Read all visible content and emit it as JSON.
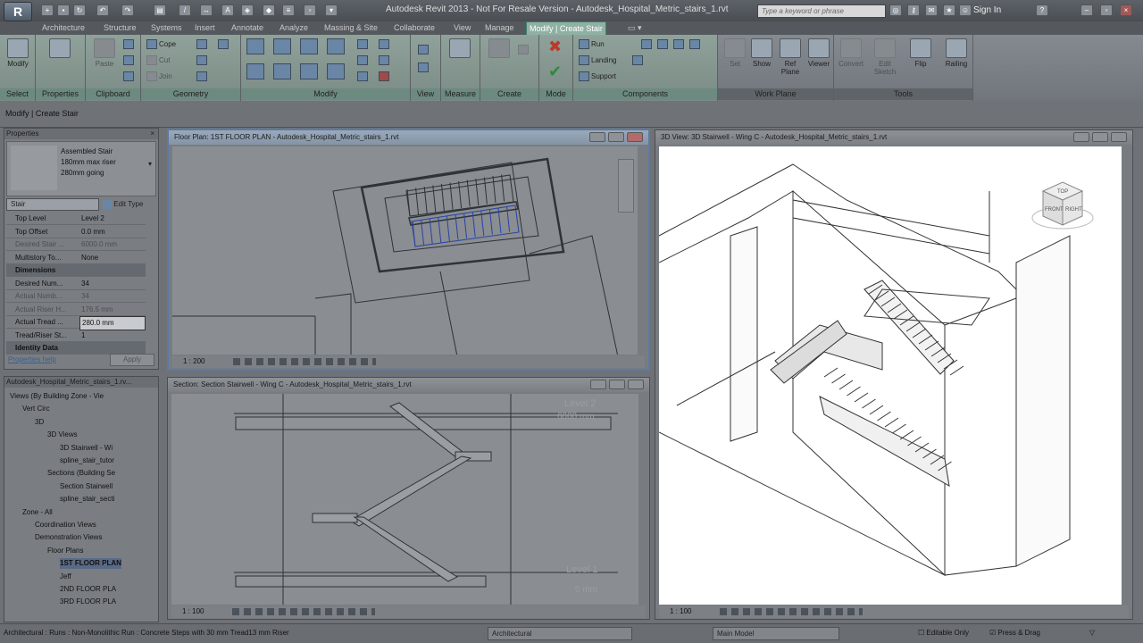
{
  "app": {
    "title": "Autodesk Revit 2013 - Not For Resale Version -   Autodesk_Hospital_Metric_stairs_1.rvt",
    "logo": "R",
    "search_placeholder": "Type a keyword or phrase",
    "sign_in": "Sign In"
  },
  "tabs": [
    "Architecture",
    "Structure",
    "Systems",
    "Insert",
    "Annotate",
    "Analyze",
    "Massing & Site",
    "Collaborate",
    "View",
    "Manage",
    "Modify | Create Stair"
  ],
  "ribbon": {
    "select": {
      "label": "Select",
      "modify": "Modify"
    },
    "properties": {
      "label": "Properties"
    },
    "clipboard": {
      "label": "Clipboard",
      "paste": "Paste"
    },
    "geometry": {
      "label": "Geometry",
      "cope": "Cope",
      "cut": "Cut",
      "join": "Join"
    },
    "modify": {
      "label": "Modify"
    },
    "view": {
      "label": "View"
    },
    "measure": {
      "label": "Measure"
    },
    "create": {
      "label": "Create"
    },
    "mode": {
      "label": "Mode"
    },
    "components": {
      "label": "Components",
      "run": "Run",
      "landing": "Landing",
      "support": "Support"
    },
    "workplane": {
      "label": "Work Plane",
      "set": "Set",
      "show": "Show",
      "refplane": "Ref Plane",
      "viewer": "Viewer"
    },
    "tools": {
      "label": "Tools",
      "convert": "Convert",
      "edit_sketch": "Edit Sketch",
      "flip": "Flip",
      "railing": "Railing"
    }
  },
  "options_bar": "Modify | Create Stair",
  "properties": {
    "header": "Properties",
    "type_line1": "Assembled Stair",
    "type_line2": "180mm max riser",
    "type_line3": "280mm going",
    "category": "Stair",
    "edit_type": "Edit Type",
    "rows": [
      {
        "name": "Top Level",
        "value": "Level 2",
        "kind": "row"
      },
      {
        "name": "Top Offset",
        "value": "0.0 mm",
        "kind": "row"
      },
      {
        "name": "Desired Stair ...",
        "value": "6000.0 mm",
        "kind": "grey"
      },
      {
        "name": "Multistory To...",
        "value": "None",
        "kind": "row"
      },
      {
        "name": "Dimensions",
        "value": "",
        "kind": "group"
      },
      {
        "name": "Desired Num...",
        "value": "34",
        "kind": "row"
      },
      {
        "name": "Actual Numb...",
        "value": "34",
        "kind": "grey"
      },
      {
        "name": "Actual Riser H...",
        "value": "176.5 mm",
        "kind": "grey"
      },
      {
        "name": "Actual Tread ...",
        "value": "280.0 mm",
        "kind": "row"
      },
      {
        "name": "Tread/Riser St...",
        "value": "1",
        "kind": "row"
      },
      {
        "name": "Identity Data",
        "value": "",
        "kind": "group"
      }
    ],
    "help_link": "Properties help",
    "apply": "Apply"
  },
  "browser": {
    "header": "Autodesk_Hospital_Metric_stairs_1.rv...",
    "items": [
      {
        "label": "Views (By Building Zone - Vie",
        "indent": 0,
        "sel": false
      },
      {
        "label": "Vert Circ",
        "indent": 1,
        "sel": false
      },
      {
        "label": "3D",
        "indent": 2,
        "sel": false
      },
      {
        "label": "3D Views",
        "indent": 3,
        "sel": false
      },
      {
        "label": "3D Stairwell - Wi",
        "indent": 4,
        "sel": false
      },
      {
        "label": "spline_stair_tutor",
        "indent": 4,
        "sel": false
      },
      {
        "label": "Sections (Building Se",
        "indent": 3,
        "sel": false
      },
      {
        "label": "Section Stairwell",
        "indent": 4,
        "sel": false
      },
      {
        "label": "spline_stair_secti",
        "indent": 4,
        "sel": false
      },
      {
        "label": "Zone - All",
        "indent": 1,
        "sel": false
      },
      {
        "label": "Coordination Views",
        "indent": 2,
        "sel": false
      },
      {
        "label": "Demonstration Views",
        "indent": 2,
        "sel": false
      },
      {
        "label": "Floor Plans",
        "indent": 3,
        "sel": false
      },
      {
        "label": "1ST FLOOR PLAN",
        "indent": 4,
        "sel": true
      },
      {
        "label": "Jeff",
        "indent": 4,
        "sel": false
      },
      {
        "label": "2ND FLOOR PLA",
        "indent": 4,
        "sel": false
      },
      {
        "label": "3RD FLOOR PLA",
        "indent": 4,
        "sel": false
      }
    ]
  },
  "views": {
    "plan": {
      "title": "Floor Plan: 1ST FLOOR PLAN - Autodesk_Hospital_Metric_stairs_1.rvt",
      "scale": "1 : 200"
    },
    "section": {
      "title": "Section: Section Stairwell - Wing C - Autodesk_Hospital_Metric_stairs_1.rvt",
      "scale": "1 : 100",
      "level2": "Level 2",
      "level2_elev": "6000 mm",
      "level1": "Level 1",
      "level1_elev": "0 mm"
    },
    "view3d": {
      "title": "3D View: 3D Stairwell - Wing C - Autodesk_Hospital_Metric_stairs_1.rvt",
      "scale": "1 : 100",
      "cube_top": "TOP",
      "cube_front": "FRONT",
      "cube_right": "RIGHT"
    }
  },
  "status": {
    "text": "Architectural : Runs : Non-Monolithic Run : Concrete Steps with 30 mm Tread13 mm Riser",
    "workset": "Architectural",
    "design_option": "Main Model",
    "editable_only": "Editable Only",
    "press_drag": "Press & Drag"
  }
}
